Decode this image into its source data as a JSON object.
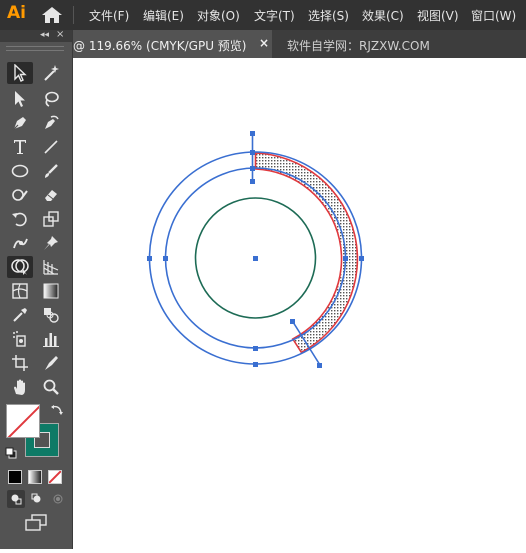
{
  "app": {
    "logo": "Ai"
  },
  "menu": {
    "items": [
      "文件(F)",
      "编辑(E)",
      "对象(O)",
      "文字(T)",
      "选择(S)",
      "效果(C)",
      "视图(V)",
      "窗口(W)"
    ]
  },
  "toolbar": {
    "collapse": "◂◂",
    "close": "×",
    "tools": [
      {
        "name": "selection-tool",
        "icon": "selection-arrow-icon"
      },
      {
        "name": "magic-wand-tool",
        "icon": "magic-wand-icon"
      },
      {
        "name": "direct-selection-tool",
        "icon": "direct-selection-icon"
      },
      {
        "name": "lasso-tool",
        "icon": "lasso-icon"
      },
      {
        "name": "pen-tool",
        "icon": "pen-icon"
      },
      {
        "name": "curvature-tool",
        "icon": "curvature-icon"
      },
      {
        "name": "type-tool",
        "icon": "type-icon"
      },
      {
        "name": "line-tool",
        "icon": "line-icon"
      },
      {
        "name": "ellipse-tool",
        "icon": "ellipse-icon"
      },
      {
        "name": "paintbrush-tool",
        "icon": "paintbrush-icon"
      },
      {
        "name": "shaper-tool",
        "icon": "shaper-icon"
      },
      {
        "name": "eraser-tool",
        "icon": "eraser-icon"
      },
      {
        "name": "rotate-tool",
        "icon": "rotate-icon"
      },
      {
        "name": "scale-tool",
        "icon": "scale-icon"
      },
      {
        "name": "puppet-warp-tool",
        "icon": "puppet-warp-icon"
      },
      {
        "name": "pin-tool",
        "icon": "pin-icon"
      },
      {
        "name": "shape-builder-tool",
        "icon": "shape-builder-icon"
      },
      {
        "name": "perspective-grid-tool",
        "icon": "perspective-grid-icon"
      },
      {
        "name": "mesh-tool",
        "icon": "mesh-icon"
      },
      {
        "name": "gradient-tool",
        "icon": "gradient-icon"
      },
      {
        "name": "eyedropper-tool",
        "icon": "eyedropper-icon"
      },
      {
        "name": "blend-tool",
        "icon": "blend-icon"
      },
      {
        "name": "symbol-sprayer-tool",
        "icon": "symbol-sprayer-icon"
      },
      {
        "name": "column-graph-tool",
        "icon": "column-graph-icon"
      },
      {
        "name": "artboard-tool",
        "icon": "artboard-icon"
      },
      {
        "name": "slice-tool",
        "icon": "slice-icon"
      },
      {
        "name": "hand-tool",
        "icon": "hand-icon"
      },
      {
        "name": "zoom-tool",
        "icon": "zoom-icon"
      }
    ],
    "stroke_color": "#0e7a66",
    "fill": "none"
  },
  "tabs": {
    "active_title": "@ 119.66% (CMYK/GPU 预览)",
    "close": "×",
    "second": "软件自学网：RJZXW.COM"
  },
  "colors": {
    "accent_blue": "#3a6fd1",
    "selection_red": "#e0393e",
    "inner_ring": "#1d6b55",
    "menubar": "#323232",
    "panel": "#535353"
  }
}
